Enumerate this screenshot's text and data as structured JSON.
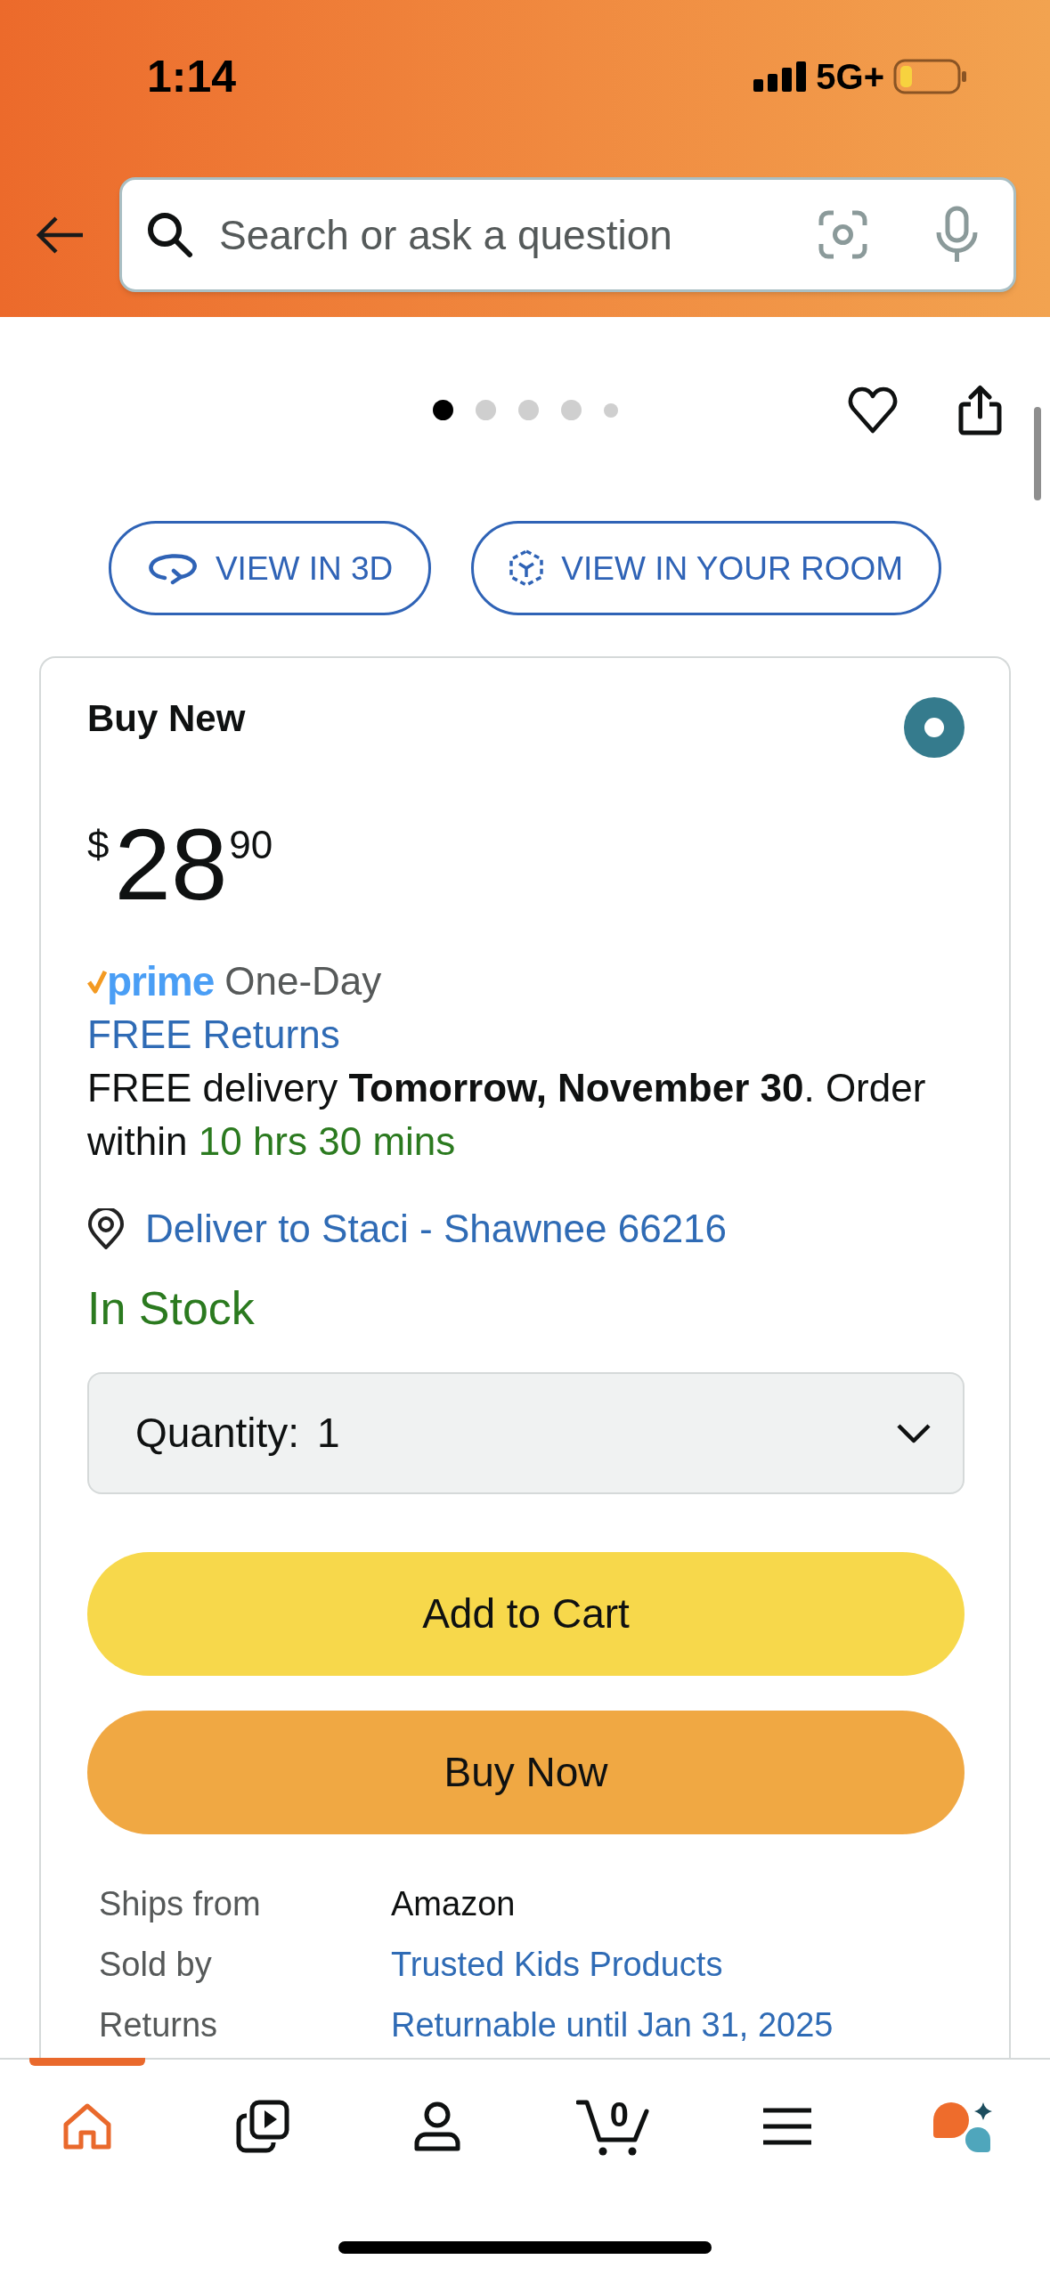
{
  "status_bar": {
    "time": "1:14",
    "network": "5G+"
  },
  "search": {
    "placeholder": "Search or ask a question"
  },
  "gallery": {
    "dots": [
      {
        "selected": true
      },
      {
        "selected": false
      },
      {
        "selected": false
      },
      {
        "selected": false
      },
      {
        "selected": false
      }
    ]
  },
  "view_buttons": [
    {
      "label": "VIEW IN 3D"
    },
    {
      "label": "VIEW IN YOUR ROOM"
    }
  ],
  "buy_box": {
    "title": "Buy New",
    "selected": true,
    "price": {
      "currency": "$",
      "whole": "28",
      "fraction": "90"
    },
    "prime": {
      "logo": "prime",
      "speed": "One-Day"
    },
    "returns_link": "FREE Returns",
    "delivery": {
      "text": "FREE delivery **Tomorrow, November 30**. Order within",
      "countdown": "10 hrs 30 mins"
    },
    "location": "Deliver to Staci - Shawnee 66216",
    "stock": "In Stock",
    "quantity": {
      "label": "Quantity:",
      "value": "1"
    },
    "buttons": [
      {
        "kind": "cart",
        "label": "Add to Cart"
      },
      {
        "kind": "buy",
        "label": "Buy Now"
      }
    ],
    "details": [
      {
        "label": "Ships from",
        "value": "Amazon",
        "link": false
      },
      {
        "label": "Sold by",
        "value": "Trusted Kids Products",
        "link": true
      },
      {
        "label": "Returns",
        "value": "Returnable until Jan 31, 2025",
        "link": true
      }
    ]
  },
  "tab_bar": {
    "items": [
      {
        "selected": true
      },
      {
        "selected": false
      },
      {
        "selected": false
      },
      {
        "selected": false,
        "count": "0"
      },
      {
        "selected": false
      },
      {
        "selected": false
      }
    ]
  }
}
